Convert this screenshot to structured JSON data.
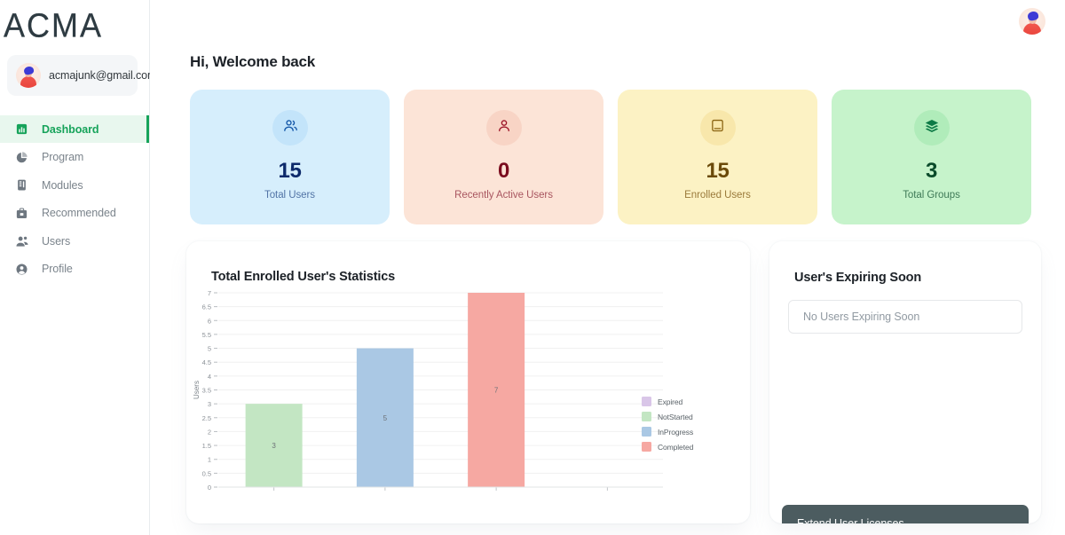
{
  "brand": {
    "logo_text": "ACMA"
  },
  "sidebar": {
    "user": {
      "email": "acmajunk@gmail.com",
      "avatar_icon": "user-avatar-icon"
    },
    "items": [
      {
        "label": "Dashboard",
        "icon": "bar-chart-icon",
        "active": true
      },
      {
        "label": "Program",
        "icon": "pie-chart-icon",
        "active": false
      },
      {
        "label": "Modules",
        "icon": "modules-icon",
        "active": false
      },
      {
        "label": "Recommended",
        "icon": "briefcase-icon",
        "active": false
      },
      {
        "label": "Users",
        "icon": "people-icon",
        "active": false
      },
      {
        "label": "Profile",
        "icon": "person-circle-icon",
        "active": false
      }
    ]
  },
  "topbar": {
    "avatar_icon": "account-avatar-icon"
  },
  "header": {
    "greeting": "Hi, Welcome back"
  },
  "stats": [
    {
      "value": "15",
      "label": "Total Users",
      "icon": "users-group-icon",
      "bg": "#d6eefc",
      "circle": "#c4e5fa",
      "value_color": "#0d2a6b",
      "label_color": "#5274a6",
      "icon_color": "#1457a8"
    },
    {
      "value": "0",
      "label": "Recently Active Users",
      "icon": "user-single-icon",
      "bg": "#fce4d7",
      "circle": "#f9d5c6",
      "value_color": "#7a0c1e",
      "label_color": "#a8555f",
      "icon_color": "#9c1428"
    },
    {
      "value": "15",
      "label": "Enrolled Users",
      "icon": "book-icon",
      "bg": "#fcf2c4",
      "circle": "#f7e8ad",
      "value_color": "#6b4a09",
      "label_color": "#9a7a3b",
      "icon_color": "#8a6310"
    },
    {
      "value": "3",
      "label": "Total Groups",
      "icon": "layers-icon",
      "bg": "#c6f3cb",
      "circle": "#b2ecbb",
      "value_color": "#0a4a2a",
      "label_color": "#3f7a57",
      "icon_color": "#0d7a46"
    }
  ],
  "chart_panel": {
    "title": "Total Enrolled User's Statistics"
  },
  "side_panel": {
    "title": "User's Expiring Soon",
    "empty_text": "No Users Expiring Soon",
    "extend_button": "Extend User Licenses"
  },
  "chart_data": {
    "type": "bar",
    "title": "Total Enrolled User's Statistics",
    "xlabel": "",
    "ylabel": "Users",
    "categories": [
      "NotStarted",
      "InProgress",
      "Completed",
      "Expired"
    ],
    "values": [
      3,
      5,
      7,
      0
    ],
    "data_labels": [
      "3",
      "5",
      "7",
      ""
    ],
    "colors": [
      "#c3e6c3",
      "#aac8e4",
      "#f6a8a2",
      "#d9c6e8"
    ],
    "ylim": [
      0,
      7
    ],
    "ytick_step": 0.5,
    "ytick_labels": [
      "0",
      "0.5",
      "1",
      "1.5",
      "2",
      "2.5",
      "3",
      "3.5",
      "4",
      "4.5",
      "5",
      "5.5",
      "6",
      "6.5",
      "7"
    ],
    "grid": true,
    "legend_position": "right-bottom",
    "legend": [
      {
        "name": "Expired",
        "color": "#d9c6e8"
      },
      {
        "name": "NotStarted",
        "color": "#c3e6c3"
      },
      {
        "name": "InProgress",
        "color": "#aac8e4"
      },
      {
        "name": "Completed",
        "color": "#f6a8a2"
      }
    ]
  }
}
